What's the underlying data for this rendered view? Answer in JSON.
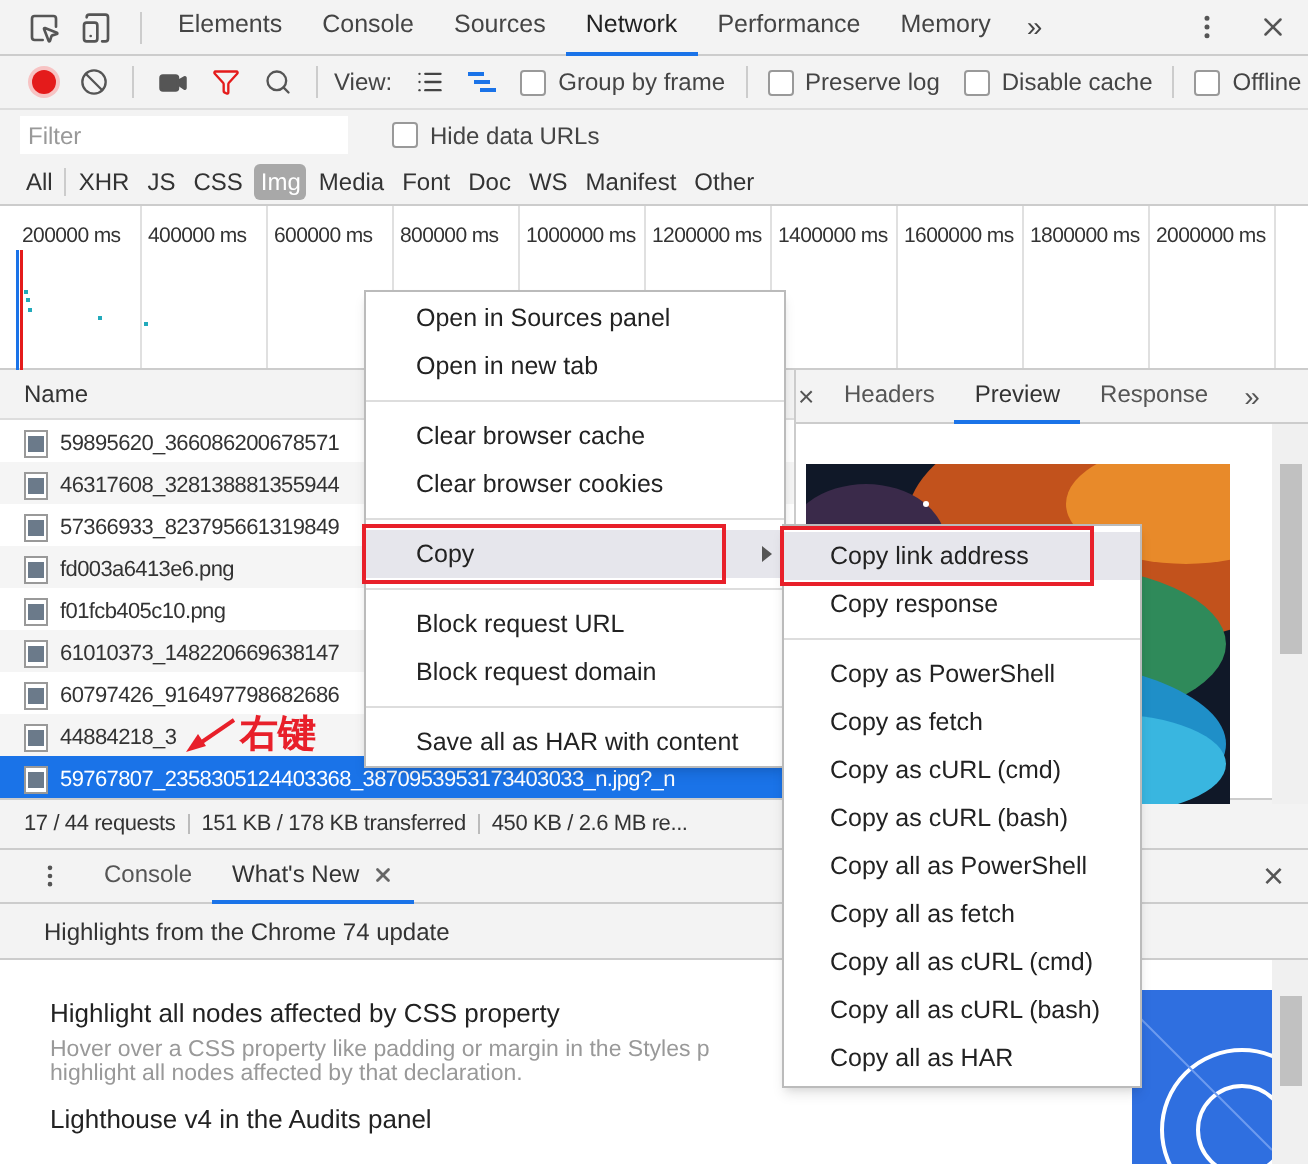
{
  "top_tabs": [
    {
      "label": "Elements",
      "selected": false
    },
    {
      "label": "Console",
      "selected": false
    },
    {
      "label": "Sources",
      "selected": false
    },
    {
      "label": "Network",
      "selected": true
    },
    {
      "label": "Performance",
      "selected": false
    },
    {
      "label": "Memory",
      "selected": false
    }
  ],
  "top_more": "»",
  "toolbar": {
    "recording": true,
    "view_label": "View:",
    "checkboxes": [
      {
        "label": "Group by frame",
        "checked": false
      },
      {
        "label": "Preserve log",
        "checked": false
      },
      {
        "label": "Disable cache",
        "checked": false
      },
      {
        "label": "Offline",
        "checked": false
      }
    ]
  },
  "filter": {
    "placeholder": "Filter",
    "hide_data_urls": {
      "label": "Hide data URLs",
      "checked": false
    }
  },
  "type_filters": [
    {
      "label": "All",
      "selected": false
    },
    {
      "label": "XHR",
      "selected": false
    },
    {
      "label": "JS",
      "selected": false
    },
    {
      "label": "CSS",
      "selected": false
    },
    {
      "label": "Img",
      "selected": true
    },
    {
      "label": "Media",
      "selected": false
    },
    {
      "label": "Font",
      "selected": false
    },
    {
      "label": "Doc",
      "selected": false
    },
    {
      "label": "WS",
      "selected": false
    },
    {
      "label": "Manifest",
      "selected": false
    },
    {
      "label": "Other",
      "selected": false
    }
  ],
  "timeline": {
    "ticks": [
      "200000 ms",
      "400000 ms",
      "600000 ms",
      "800000 ms",
      "1000000 ms",
      "1200000 ms",
      "1400000 ms",
      "1600000 ms",
      "1800000 ms",
      "2000000 ms"
    ]
  },
  "request_list": {
    "header": "Name",
    "rows": [
      {
        "name": "59895620_366086200678571",
        "selected": false
      },
      {
        "name": "46317608_328138881355944",
        "selected": false
      },
      {
        "name": "57366933_823795661319849",
        "selected": false
      },
      {
        "name": "fd003a6413e6.png",
        "selected": false
      },
      {
        "name": "f01fcb405c10.png",
        "selected": false
      },
      {
        "name": "61010373_148220669638147",
        "selected": false
      },
      {
        "name": "60797426_916497798682686",
        "selected": false
      },
      {
        "name": "44884218_3",
        "selected": false
      },
      {
        "name": "59767807_2358305124403368_3870953953173403033_n.jpg?_n",
        "selected": true
      }
    ]
  },
  "detail_tabs": {
    "close": "×",
    "tabs": [
      {
        "label": "Headers",
        "selected": false
      },
      {
        "label": "Preview",
        "selected": true
      },
      {
        "label": "Response",
        "selected": false
      }
    ],
    "more": "»"
  },
  "status_bar": [
    "17 / 44 requests",
    "151 KB / 178 KB transferred",
    "450 KB / 2.6 MB re..."
  ],
  "drawer": {
    "tabs": [
      {
        "label": "Console",
        "selected": false,
        "closable": false
      },
      {
        "label": "What's New",
        "selected": true,
        "closable": true
      }
    ],
    "close_mark": "×",
    "banner": "Highlights from the Chrome 74 update",
    "features": [
      {
        "title": "Highlight all nodes affected by CSS property",
        "description": [
          "Hover over a CSS property like padding or margin in the Styles p",
          "highlight all nodes affected by that declaration."
        ]
      },
      {
        "title": "Lighthouse v4 in the Audits panel"
      }
    ]
  },
  "context_menu": {
    "groups": [
      [
        {
          "label": "Open in Sources panel",
          "highlighted": false,
          "outlined": false,
          "submenu": false
        },
        {
          "label": "Open in new tab",
          "highlighted": false,
          "outlined": false,
          "submenu": false
        }
      ],
      [
        {
          "label": "Clear browser cache",
          "highlighted": false,
          "outlined": false,
          "submenu": false
        },
        {
          "label": "Clear browser cookies",
          "highlighted": false,
          "outlined": false,
          "submenu": false
        }
      ],
      [
        {
          "label": "Copy",
          "highlighted": true,
          "outlined": true,
          "submenu": true
        }
      ],
      [
        {
          "label": "Block request URL",
          "highlighted": false,
          "outlined": false,
          "submenu": false
        },
        {
          "label": "Block request domain",
          "highlighted": false,
          "outlined": false,
          "submenu": false
        }
      ],
      [
        {
          "label": "Save all as HAR with content",
          "highlighted": false,
          "outlined": false,
          "submenu": false
        }
      ]
    ]
  },
  "submenu": {
    "groups": [
      [
        {
          "label": "Copy link address",
          "highlighted": true,
          "outlined": true
        },
        {
          "label": "Copy response",
          "highlighted": false,
          "outlined": false
        }
      ],
      [
        {
          "label": "Copy as PowerShell",
          "highlighted": false,
          "outlined": false
        },
        {
          "label": "Copy as fetch",
          "highlighted": false,
          "outlined": false
        },
        {
          "label": "Copy as cURL (cmd)",
          "highlighted": false,
          "outlined": false
        },
        {
          "label": "Copy as cURL (bash)",
          "highlighted": false,
          "outlined": false
        },
        {
          "label": "Copy all as PowerShell",
          "highlighted": false,
          "outlined": false
        },
        {
          "label": "Copy all as fetch",
          "highlighted": false,
          "outlined": false
        },
        {
          "label": "Copy all as cURL (cmd)",
          "highlighted": false,
          "outlined": false
        },
        {
          "label": "Copy all as cURL (bash)",
          "highlighted": false,
          "outlined": false
        },
        {
          "label": "Copy all as HAR",
          "highlighted": false,
          "outlined": false
        }
      ]
    ]
  },
  "annotation": {
    "text": "右键"
  }
}
